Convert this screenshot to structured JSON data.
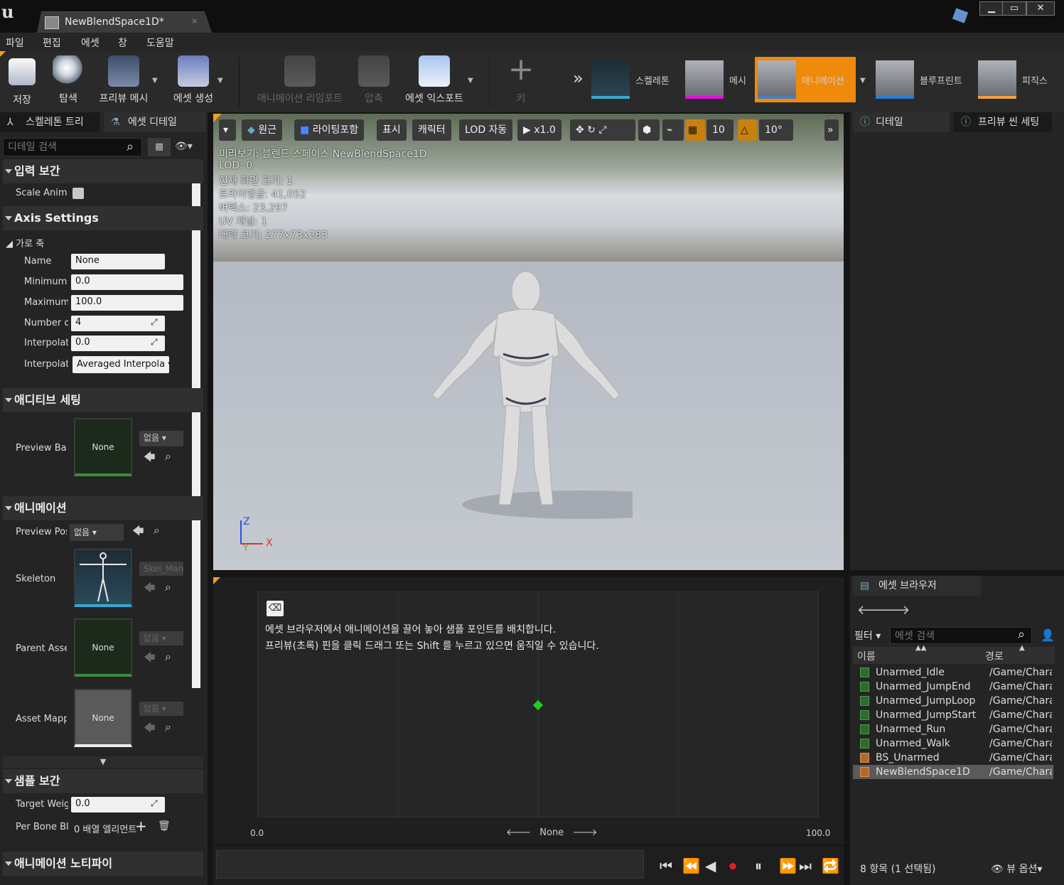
{
  "window": {
    "tab_title": "NewBlendSpace1D*",
    "tab_close": "×",
    "controls": {
      "minimize": "▁",
      "maximize": "▭",
      "close": "✕"
    }
  },
  "menu": [
    "파일",
    "편집",
    "에셋",
    "창",
    "도움말"
  ],
  "toolbar": {
    "save": "저장",
    "browse": "탐색",
    "preview_mesh": "프리뷰 메시",
    "create_asset": "에셋 생성",
    "reimport": "애니메이션 리임포트",
    "compress": "압축",
    "export": "에셋 익스포트",
    "key": "키",
    "more": "»",
    "modes": {
      "skeleton": "스켈레톤",
      "mesh": "메시",
      "animation": "애니메이션",
      "blueprint": "블루프린트",
      "physics": "피직스"
    },
    "accent": "#f08a0a"
  },
  "left_panel": {
    "tabs": {
      "skeleton_tree": "스켈레톤 트리",
      "asset_details": "에셋 디테일"
    },
    "search_placeholder": "디테일 검색",
    "sections": {
      "input_interp": "입력 보간",
      "axis_settings": "Axis Settings",
      "horizontal_axis": "가로 축",
      "additive": "애디티브 세팅",
      "animation": "애니메이션",
      "sample_interp": "샘플 보간",
      "notify": "애니메이션 노티파이"
    },
    "fields": {
      "scale_anim": "Scale Animation",
      "name_label": "Name",
      "name_value": "None",
      "min_label": "Minimum Axis Value",
      "min_value": "0.0",
      "max_label": "Maximum Axis Value",
      "max_value": "100.0",
      "grid_label": "Number of Grid Divisions",
      "grid_value": "4",
      "interp_time_label": "Interpolation Time",
      "interp_time_value": "0.0",
      "interp_type_label": "Interpolation Type",
      "interp_type_value": "Averaged Interpola",
      "preview_base_label": "Preview Base Pose",
      "preview_base_thumb": "None",
      "preview_base_dd": "없음",
      "preview_pose_label": "Preview Pose Asset",
      "preview_pose_dd": "없음",
      "skeleton_label": "Skeleton",
      "skeleton_dd": "Skel_Mannequin",
      "parent_label": "Parent Asset",
      "parent_thumb": "None",
      "parent_dd": "없음",
      "mapping_label": "Asset Mapping Table",
      "mapping_thumb": "None",
      "mapping_dd": "없음",
      "target_weight_label": "Target Weight Interpolation",
      "target_weight_value": "0.0",
      "per_bone_label": "Per Bone Blend",
      "per_bone_value": "0 배열 엘리먼트"
    }
  },
  "viewport": {
    "buttons": {
      "perspective": "원근",
      "lighting": "라이팅포함",
      "show": "표시",
      "character": "캐릭터",
      "lod": "LOD 자동",
      "speed": "x1.0",
      "grid_snap": "10",
      "angle_snap": "10°"
    },
    "info": [
      "미리보기: 블렌드 스페이스 NewBlendSpace1D",
      "LOD: 0",
      "현재 화면 크기: 1",
      "트라이앵글: 41,052",
      "버텍스: 23,297",
      "UV 채널: 1",
      "대략 크기: 277x73x283"
    ],
    "axes": {
      "z": "Z",
      "x": "X",
      "y": "Y"
    }
  },
  "blend_space": {
    "hint_line1": "에셋 브라우저에서 애니메이션을 끌어 놓아 샘플 포인트를 배치합니다.",
    "hint_line2": "프리뷰(초록) 핀을 클릭 드래그 또는 Shift 를 누르고 있으면 움직일 수 있습니다.",
    "axis_min": "0.0",
    "axis_max": "100.0",
    "axis_name": "None",
    "preview_pin_fraction": 0.5
  },
  "right_panel": {
    "details_tab": "디테일",
    "preview_scene_tab": "프리뷰 씬 세팅",
    "asset_browser_tab": "에셋 브라우저",
    "filter": "필터",
    "search_placeholder": "에셋 검색",
    "col_name": "이름",
    "col_path": "경로",
    "assets": [
      {
        "name": "Unarmed_Idle",
        "path": "/Game/Characters"
      },
      {
        "name": "Unarmed_JumpEnd",
        "path": "/Game/Characters"
      },
      {
        "name": "Unarmed_JumpLoop",
        "path": "/Game/Characters"
      },
      {
        "name": "Unarmed_JumpStart",
        "path": "/Game/Characters"
      },
      {
        "name": "Unarmed_Run",
        "path": "/Game/Characters"
      },
      {
        "name": "Unarmed_Walk",
        "path": "/Game/Characters"
      },
      {
        "name": "BS_Unarmed",
        "path": "/Game/Characters"
      },
      {
        "name": "NewBlendSpace1D",
        "path": "/Game/Characters"
      }
    ],
    "status": "8 항목 (1 선택됨)",
    "view_options": "뷰 옵션"
  }
}
